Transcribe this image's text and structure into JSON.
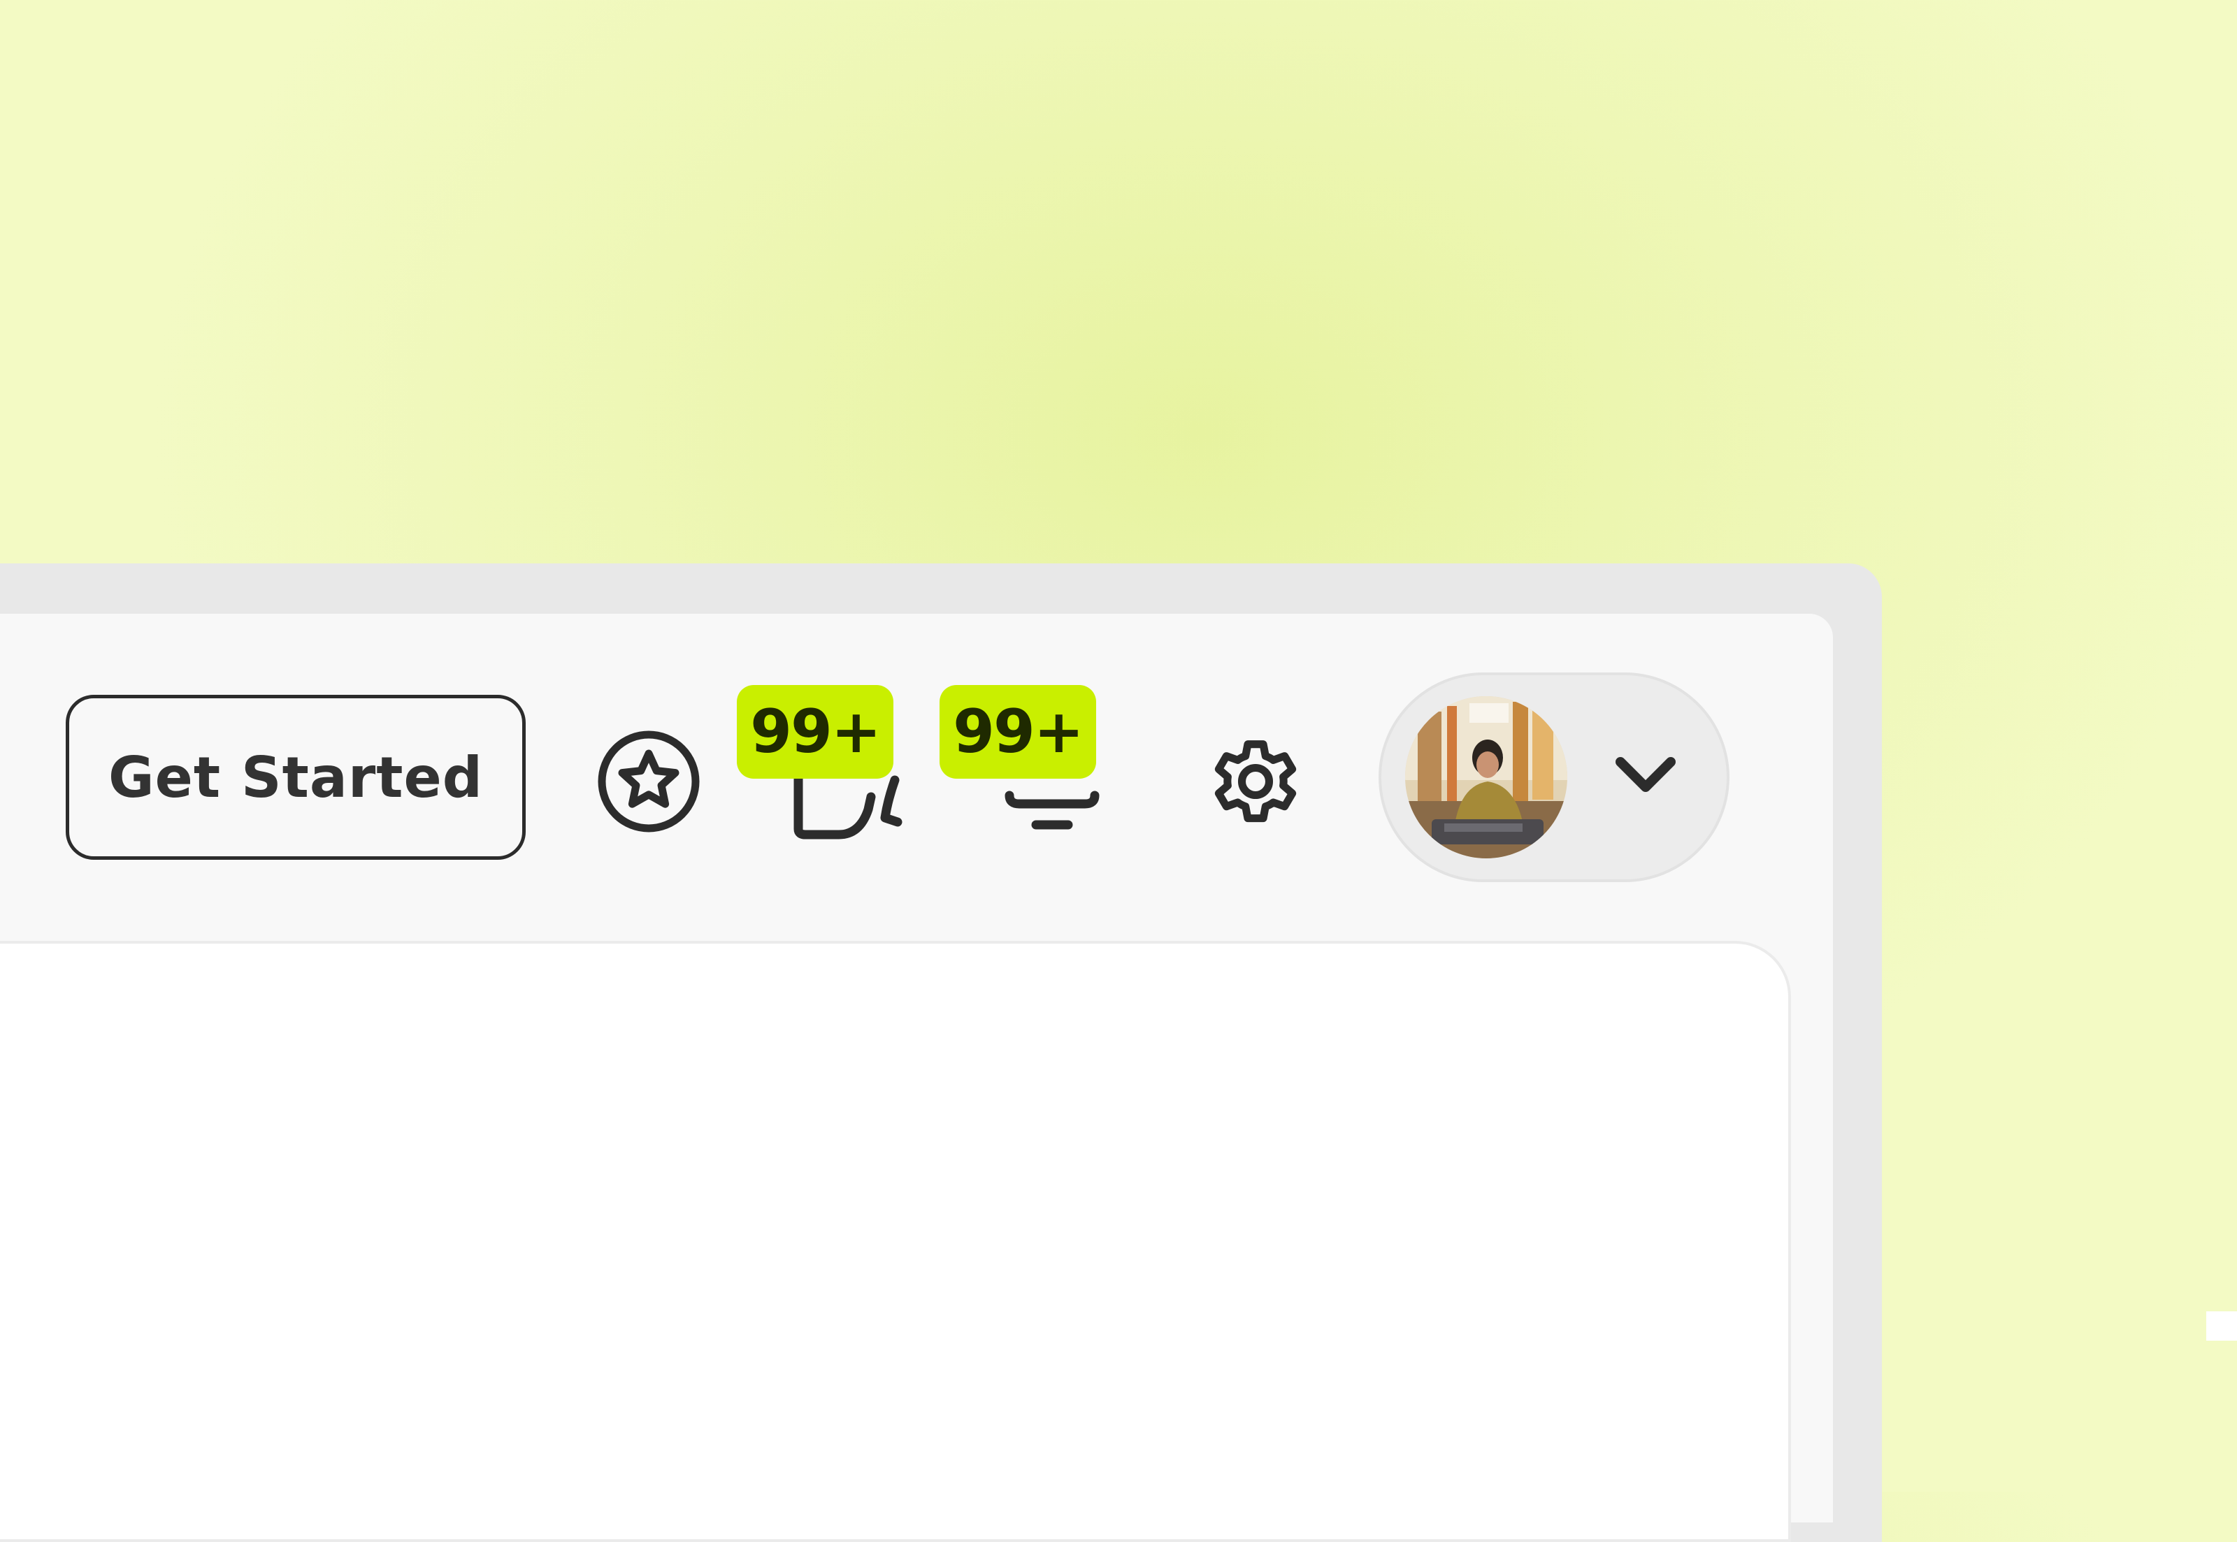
{
  "header": {
    "get_started_label": "Get Started",
    "icons": {
      "favorites": "star-circle-icon",
      "messages": "chat-icon",
      "notifications": "bell-icon",
      "settings": "gear-icon",
      "profile_menu": "chevron-down-icon"
    },
    "messages_badge": "99+",
    "notifications_badge": "99+"
  },
  "profile": {
    "avatar_icon": "user-avatar-photo"
  },
  "colors": {
    "background": "#eef7b6",
    "badge": "#c9ef00",
    "panel": "#f8f8f8",
    "card": "#ffffff",
    "icon": "#2c2c2c"
  }
}
